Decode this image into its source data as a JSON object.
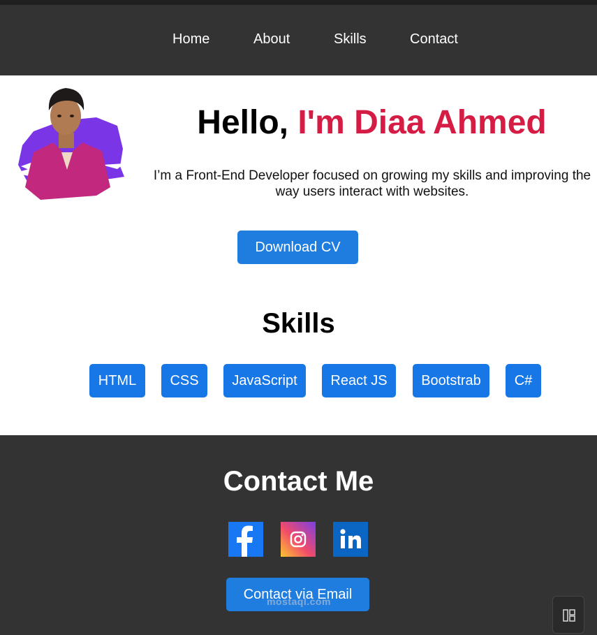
{
  "nav": {
    "items": [
      {
        "label": "Home"
      },
      {
        "label": "About"
      },
      {
        "label": "Skills"
      },
      {
        "label": "Contact"
      }
    ]
  },
  "hero": {
    "greeting": "Hello, ",
    "name": "I'm Diaa Ahmed",
    "description": "I’m a Front-End Developer focused on growing my skills and improving the way users interact with websites.",
    "cv_button": "Download CV"
  },
  "skills": {
    "title": "Skills",
    "items": [
      "HTML",
      "CSS",
      "JavaScript",
      "React JS",
      "Bootstrab",
      "C#"
    ]
  },
  "contact": {
    "title": "Contact Me",
    "email_button": "Contact via Email",
    "socials": [
      {
        "icon": "facebook-icon"
      },
      {
        "icon": "instagram-icon"
      },
      {
        "icon": "linkedin-icon"
      }
    ]
  },
  "watermark": "mostaql.com",
  "colors": {
    "nav_bg": "#333333",
    "accent_name": "#d41c44",
    "button_blue": "#1f7de0"
  }
}
